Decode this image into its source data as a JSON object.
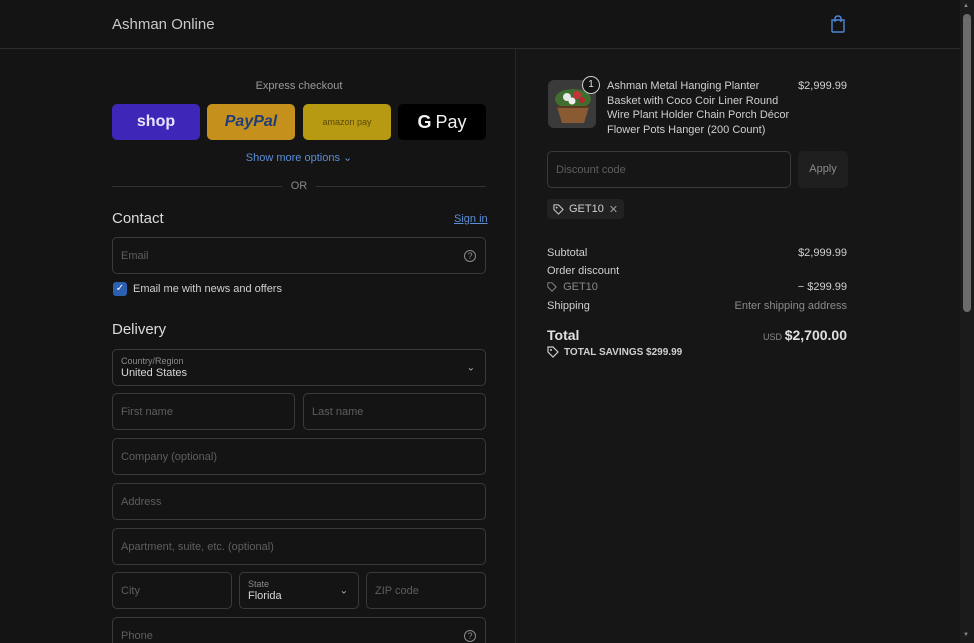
{
  "header": {
    "brand": "Ashman Online",
    "cart_icon": "shopping-bag-icon"
  },
  "express": {
    "label": "Express checkout",
    "shop_label": "shop",
    "paypal_label": "PayPal",
    "amazon_label": "amazon pay",
    "gpay_label": "Pay",
    "gpay_g": "G",
    "more_options": "Show more options ⌄",
    "or": "OR"
  },
  "contact": {
    "title": "Contact",
    "sign_in": "Sign in",
    "email_placeholder": "Email",
    "newsletter_label": "Email me with news and offers",
    "newsletter_checked": true
  },
  "delivery": {
    "title": "Delivery",
    "country_label": "Country/Region",
    "country_value": "United States",
    "first_name_placeholder": "First name",
    "last_name_placeholder": "Last name",
    "company_placeholder": "Company (optional)",
    "address_placeholder": "Address",
    "apartment_placeholder": "Apartment, suite, etc. (optional)",
    "city_placeholder": "City",
    "state_label": "State",
    "state_value": "Florida",
    "zip_placeholder": "ZIP code",
    "phone_placeholder": "Phone"
  },
  "summary": {
    "product_name": "Ashman Metal Hanging Planter Basket with Coco Coir Liner Round Wire Plant Holder Chain Porch Décor Flower Pots Hanger (200 Count)",
    "product_price": "$2,999.99",
    "quantity": "1",
    "discount_placeholder": "Discount code",
    "apply_label": "Apply",
    "applied_code": "GET10",
    "subtotal_label": "Subtotal",
    "subtotal_value": "$2,999.99",
    "order_discount_label": "Order discount",
    "discount_code": "GET10",
    "discount_value": "− $299.99",
    "shipping_label": "Shipping",
    "shipping_value": "Enter shipping address",
    "total_label": "Total",
    "total_currency": "USD",
    "total_value": "$2,700.00",
    "savings_label": "TOTAL SAVINGS $299.99"
  },
  "colors": {
    "accent": "#5b8fd6",
    "background": "#141414",
    "checkbox": "#2b5fb0"
  }
}
